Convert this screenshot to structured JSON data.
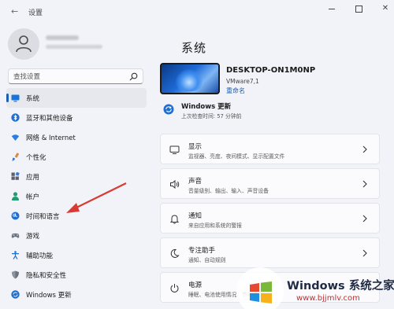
{
  "window": {
    "title": "设置",
    "back_icon": "←",
    "close_icon": "✕"
  },
  "search": {
    "placeholder": "查找设置"
  },
  "sidebar": {
    "items": [
      {
        "label": "系统",
        "icon": "monitor-icon",
        "active": true
      },
      {
        "label": "蓝牙和其他设备",
        "icon": "bluetooth-icon"
      },
      {
        "label": "网络 & Internet",
        "icon": "wifi-icon"
      },
      {
        "label": "个性化",
        "icon": "brush-icon"
      },
      {
        "label": "应用",
        "icon": "apps-icon"
      },
      {
        "label": "帐户",
        "icon": "person-icon"
      },
      {
        "label": "时间和语言",
        "icon": "globe-clock-icon"
      },
      {
        "label": "游戏",
        "icon": "gamepad-icon"
      },
      {
        "label": "辅助功能",
        "icon": "accessibility-icon"
      },
      {
        "label": "隐私和安全性",
        "icon": "shield-icon"
      },
      {
        "label": "Windows 更新",
        "icon": "update-icon"
      }
    ]
  },
  "main": {
    "title": "系统",
    "device": {
      "name": "DESKTOP-ON1M0NP",
      "model": "VMware7,1",
      "rename": "重命名"
    },
    "update": {
      "title": "Windows 更新",
      "subtitle": "上次检查时间: 57 分钟前"
    },
    "cards": [
      {
        "title": "显示",
        "desc": "监视器、亮度、夜间模式、显示配置文件",
        "icon": "display-icon"
      },
      {
        "title": "声音",
        "desc": "音量级别、输出、输入、声音设备",
        "icon": "speaker-icon"
      },
      {
        "title": "通知",
        "desc": "来自应用和系统的警报",
        "icon": "bell-icon"
      },
      {
        "title": "专注助手",
        "desc": "通知、自动规则",
        "icon": "moon-icon"
      },
      {
        "title": "电源",
        "desc": "睡眠、电池使用情况、节电模式",
        "icon": "power-icon"
      }
    ]
  },
  "watermark": {
    "brand": "Windows 系统之家",
    "url": "www.bjjmlv.com"
  },
  "colors": {
    "accent": "#1a5fb4",
    "background": "#f1f3f9",
    "annotation_arrow": "#d93a33"
  }
}
